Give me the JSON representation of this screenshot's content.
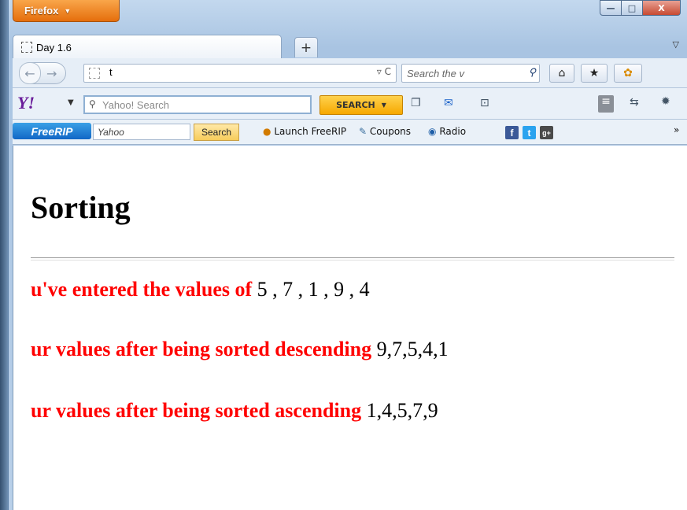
{
  "browser": {
    "menu_label": "Firefox",
    "tab_title": "Day 1.6",
    "new_tab": "+",
    "url_text": "t",
    "search_placeholder": "Search the v",
    "window_controls": {
      "minimize": "—",
      "maximize": "□",
      "close": "X"
    }
  },
  "yahoo_toolbar": {
    "logo": "Y!",
    "search_placeholder": "Yahoo! Search",
    "search_button": "SEARCH"
  },
  "freerip_toolbar": {
    "logo": "FreeRIP",
    "engine": "Yahoo",
    "search_button": "Search",
    "launch_label": "Launch FreeRIP",
    "coupons_label": "Coupons",
    "radio_label": "Radio",
    "overflow": "»"
  },
  "page": {
    "heading": "Sorting",
    "lines": [
      {
        "label": "u've entered the values of",
        "value": "5 , 7 , 1 , 9 , 4"
      },
      {
        "label": "ur values after being sorted descending",
        "value": "9,7,5,4,1"
      },
      {
        "label": "ur values after being sorted ascending",
        "value": "1,4,5,7,9"
      }
    ]
  },
  "colors": {
    "label_red": "#ff0000",
    "firefox_orange": "#e56e0c",
    "yahoo_purple": "#6a1d9a"
  }
}
